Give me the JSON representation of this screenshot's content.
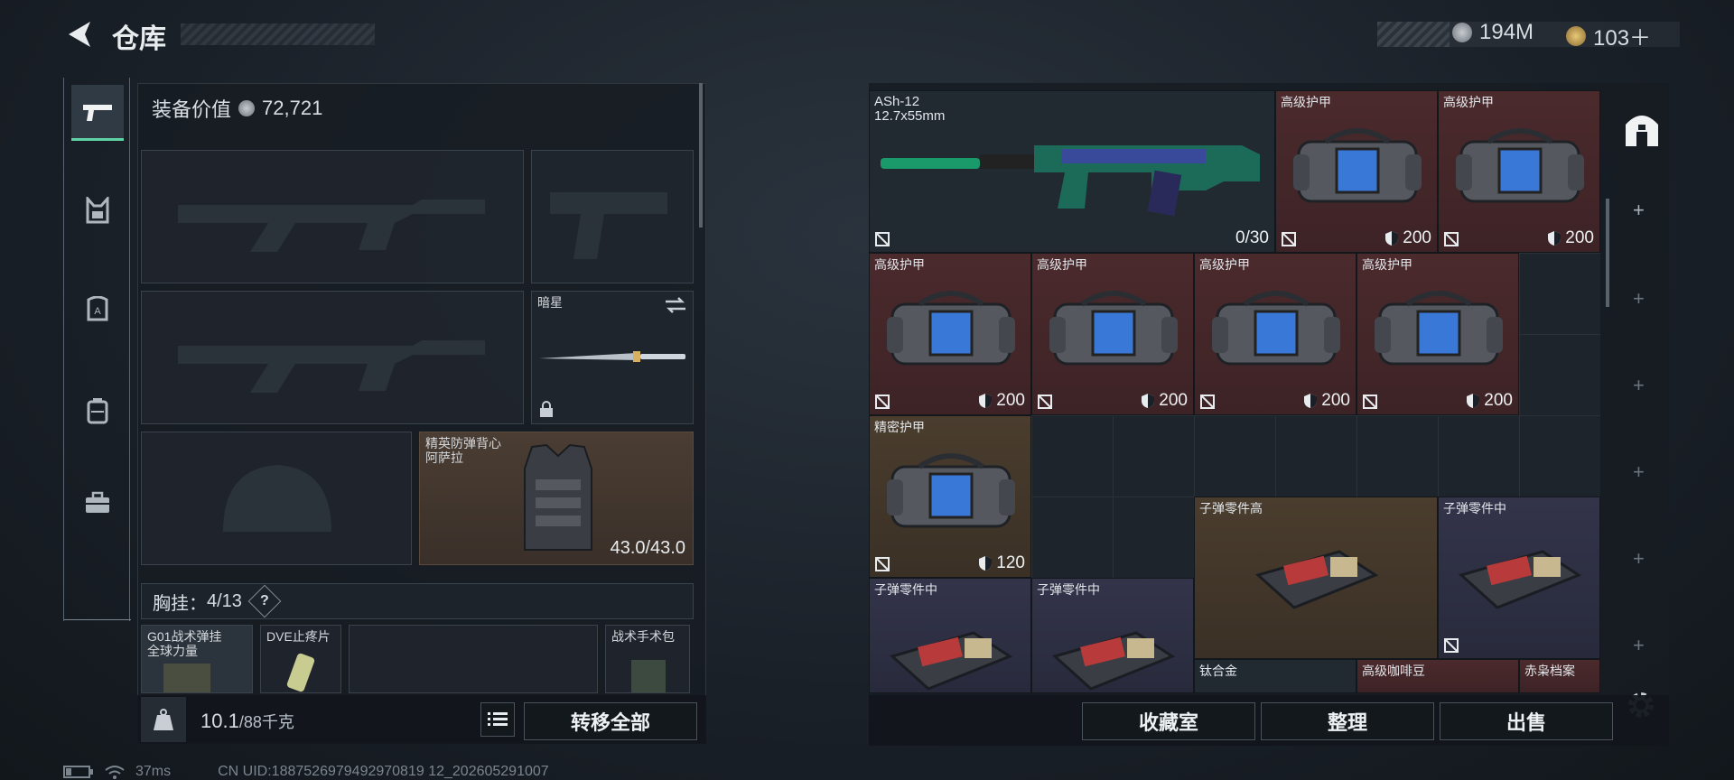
{
  "header": {
    "title": "仓库",
    "currency_silver": "194M",
    "currency_gold": "103＋"
  },
  "left": {
    "equip_value_label": "装备价值",
    "equip_value": "72,721",
    "melee_slot_name": "暗星",
    "vest_slot_name": "精英防弹背心\n阿萨拉",
    "vest_durability": "43.0/43.0",
    "chest_label": "胸挂：",
    "chest_count": "4/13",
    "chest_help": "?",
    "chest_items": [
      {
        "name": "G01战术弹挂\n全球力量"
      },
      {
        "name": "DVE止疼片"
      },
      {
        "name": ""
      },
      {
        "name": "战术手术包"
      }
    ],
    "weight_current": "10.1",
    "weight_max": "/88千克",
    "transfer_all": "转移全部"
  },
  "right": {
    "items": [
      {
        "name": "ASh-12\n12.7x55mm",
        "value": "0/30",
        "rarity": "gray"
      },
      {
        "name": "高级护甲",
        "value": "200",
        "rarity": "red"
      },
      {
        "name": "高级护甲",
        "value": "200",
        "rarity": "red"
      },
      {
        "name": "高级护甲",
        "value": "200",
        "rarity": "red"
      },
      {
        "name": "高级护甲",
        "value": "200",
        "rarity": "red"
      },
      {
        "name": "高级护甲",
        "value": "200",
        "rarity": "red"
      },
      {
        "name": "高级护甲",
        "value": "200",
        "rarity": "red"
      },
      {
        "name": "精密护甲",
        "value": "120",
        "rarity": "gold"
      },
      {
        "name": "子弹零件高",
        "value": "",
        "rarity": "gold"
      },
      {
        "name": "子弹零件中",
        "value": "",
        "rarity": "purple"
      },
      {
        "name": "子弹零件中",
        "value": "",
        "rarity": "purple"
      },
      {
        "name": "子弹零件中",
        "value": "",
        "rarity": "purple"
      },
      {
        "name": "钛合金",
        "value": "",
        "rarity": "gray"
      },
      {
        "name": "高级咖啡豆",
        "value": "",
        "rarity": "red"
      },
      {
        "name": "赤枭档案",
        "value": "",
        "rarity": "red"
      }
    ],
    "collection": "收藏室",
    "organize": "整理",
    "sell": "出售"
  },
  "status": {
    "ping": "37ms",
    "uid": "CN UID:1887526979492970819 12_202605291007"
  },
  "colors": {
    "accent": "#5fd3a6",
    "red_rarity": "#4b2a2c",
    "gold_rarity": "#4a3d2e",
    "purple_rarity": "#33344a"
  }
}
